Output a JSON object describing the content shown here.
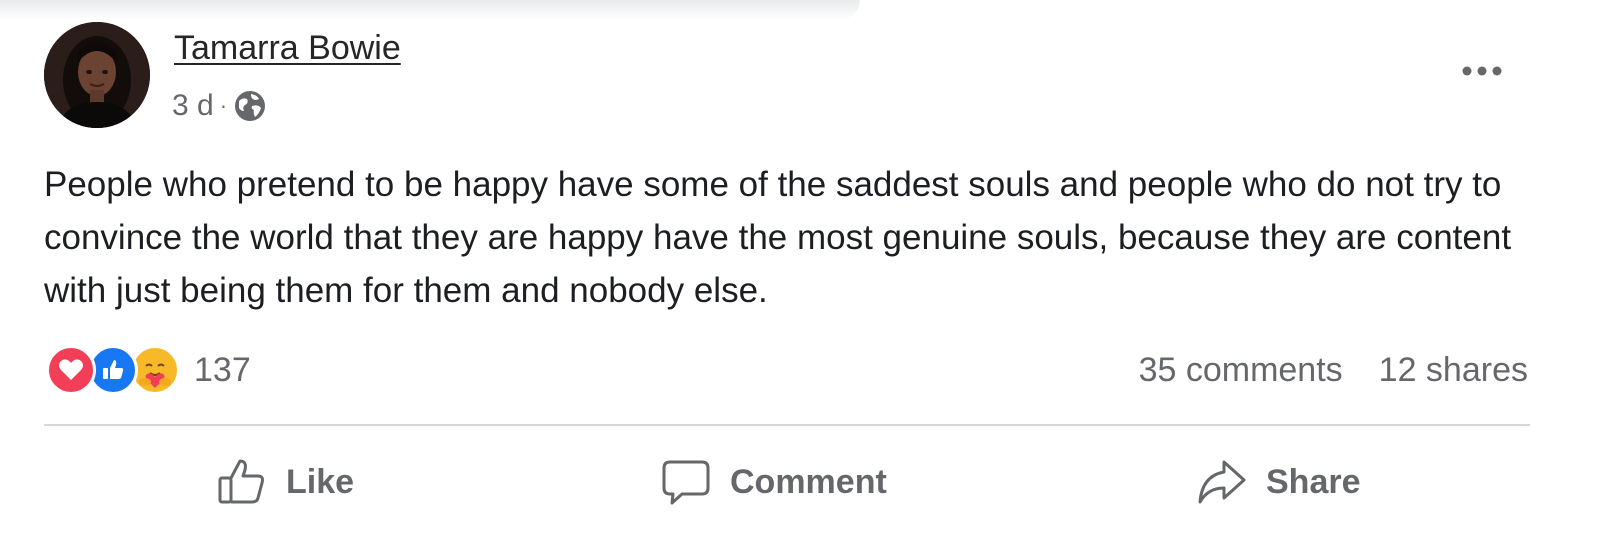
{
  "post": {
    "author": "Tamarra Bowie",
    "timestamp": "3 d",
    "separator": "·",
    "audience_icon": "globe-icon",
    "more_icon": "more-options-icon",
    "text": "People who pretend to be happy have some of the saddest souls and people who do not try to convince the world that they are happy have the most genuine souls, because they are content with just being them for them and nobody else.",
    "reactions": {
      "icons": [
        "love-reaction-icon",
        "like-reaction-icon",
        "care-reaction-icon"
      ],
      "count": "137"
    },
    "comments": "35 comments",
    "shares": "12 shares"
  },
  "actions": {
    "like_label": "Like",
    "comment_label": "Comment",
    "share_label": "Share"
  },
  "colors": {
    "like_blue": "#1877f2",
    "love_red": "#f33e58",
    "care_yellow": "#f7b928",
    "secondary_text": "#65676b"
  }
}
